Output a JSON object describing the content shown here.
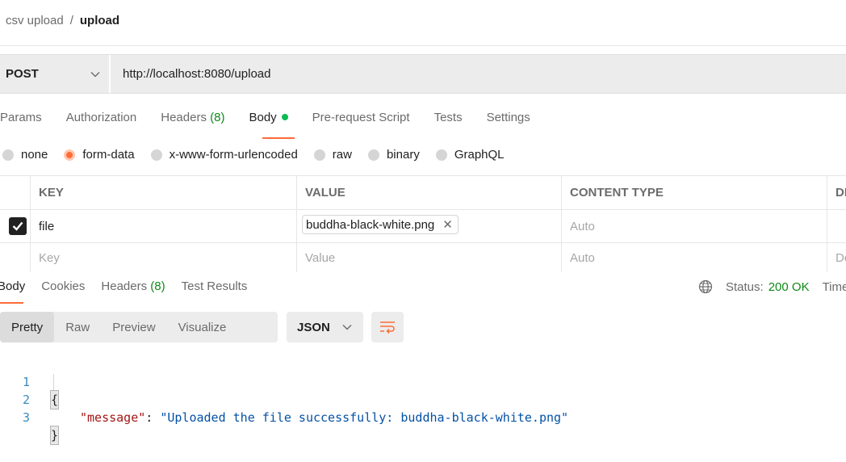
{
  "breadcrumb": {
    "parent": "csv upload",
    "separator": "/",
    "current": "upload"
  },
  "request": {
    "method": "POST",
    "url": "http://localhost:8080/upload"
  },
  "request_tabs": [
    {
      "label": "Params",
      "count": ""
    },
    {
      "label": "Authorization",
      "count": ""
    },
    {
      "label": "Headers",
      "count": "(8)"
    },
    {
      "label": "Body",
      "count": ""
    },
    {
      "label": "Pre-request Script",
      "count": ""
    },
    {
      "label": "Tests",
      "count": ""
    },
    {
      "label": "Settings",
      "count": ""
    }
  ],
  "body_types": [
    "none",
    "form-data",
    "x-www-form-urlencoded",
    "raw",
    "binary",
    "GraphQL"
  ],
  "body_type_selected": "form-data",
  "table": {
    "headers": [
      "KEY",
      "VALUE",
      "CONTENT TYPE",
      "DE"
    ],
    "rows": [
      {
        "checked": true,
        "key": "file",
        "value_file": "buddha-black-white.png",
        "content_type_placeholder": "Auto"
      }
    ],
    "placeholders": {
      "key": "Key",
      "value": "Value",
      "content_type": "Auto",
      "description": "De"
    }
  },
  "response_tabs": [
    {
      "label": "Body",
      "count": ""
    },
    {
      "label": "Cookies",
      "count": ""
    },
    {
      "label": "Headers",
      "count": "(8)"
    },
    {
      "label": "Test Results",
      "count": ""
    }
  ],
  "status": {
    "label": "Status:",
    "value": "200 OK",
    "time_label": "Time:"
  },
  "view_modes": [
    "Pretty",
    "Raw",
    "Preview",
    "Visualize"
  ],
  "view_mode_selected": "Pretty",
  "format": "JSON",
  "code": {
    "line_numbers": [
      "1",
      "2",
      "3"
    ],
    "open_brace": "{",
    "close_brace": "}",
    "key": "\"message\"",
    "colon": ": ",
    "value": "\"Uploaded the file successfully: buddha-black-white.png\""
  },
  "colors": {
    "accent": "#ff6c37",
    "success": "#0e8a16",
    "dot": "#0cbb52"
  }
}
